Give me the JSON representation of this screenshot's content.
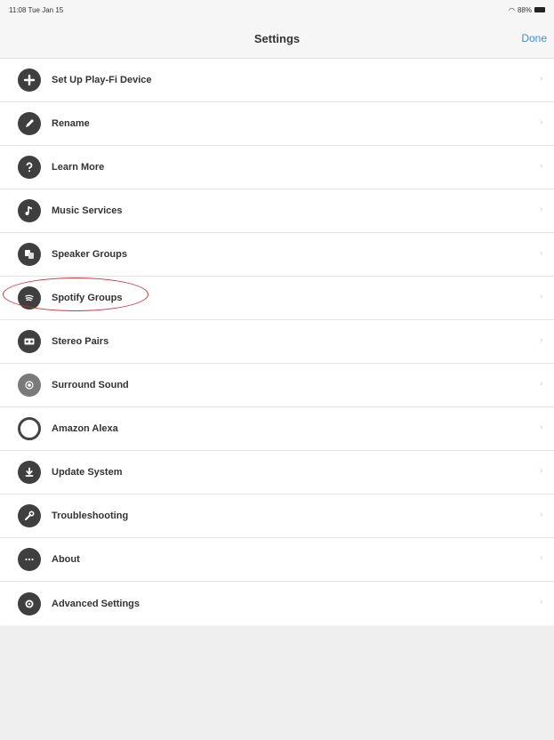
{
  "status": {
    "time": "11:08",
    "date": "Tue Jan 15",
    "battery": "88%"
  },
  "nav": {
    "title": "Settings",
    "done_label": "Done"
  },
  "items": [
    {
      "label": "Set Up Play-Fi Device",
      "icon": "plus-icon"
    },
    {
      "label": "Rename",
      "icon": "pencil-icon"
    },
    {
      "label": "Learn More",
      "icon": "question-icon"
    },
    {
      "label": "Music Services",
      "icon": "music-note-icon"
    },
    {
      "label": "Speaker Groups",
      "icon": "speaker-groups-icon"
    },
    {
      "label": "Spotify Groups",
      "icon": "spotify-icon"
    },
    {
      "label": "Stereo Pairs",
      "icon": "stereo-pairs-icon"
    },
    {
      "label": "Surround Sound",
      "icon": "surround-sound-icon"
    },
    {
      "label": "Amazon Alexa",
      "icon": "alexa-icon"
    },
    {
      "label": "Update System",
      "icon": "update-icon"
    },
    {
      "label": "Troubleshooting",
      "icon": "wrench-icon"
    },
    {
      "label": "About",
      "icon": "ellipsis-icon"
    },
    {
      "label": "Advanced Settings",
      "icon": "gear-icon"
    }
  ],
  "colors": {
    "accent": "#3b8fe0",
    "highlight": "#d2303a",
    "icon": "#3f3f3f"
  }
}
